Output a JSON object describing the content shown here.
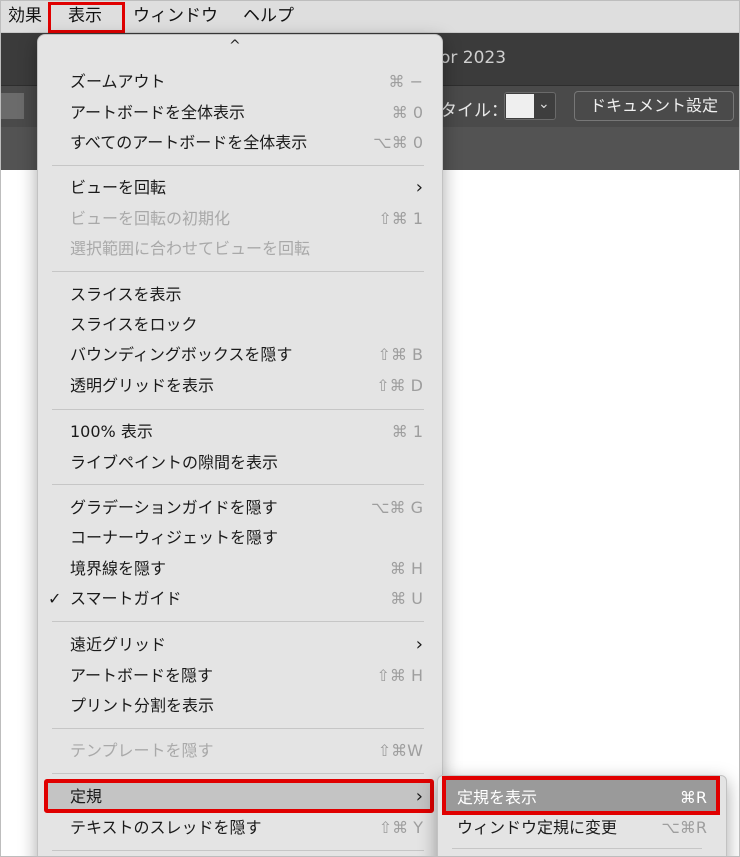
{
  "menubar": {
    "items": [
      "効果",
      "表示",
      "ウィンドウ",
      "ヘルプ"
    ]
  },
  "app": {
    "title_partial": "or 2023",
    "style_label": "タイル：",
    "document_settings_button": "ドキュメント設定"
  },
  "menu": {
    "scroll_indicator": "^",
    "items": [
      {
        "label": "ズームアウト",
        "shortcut": "⌘ −",
        "disabled": false
      },
      {
        "label": "アートボードを全体表示",
        "shortcut": "⌘ 0",
        "disabled": false
      },
      {
        "label": "すべてのアートボードを全体表示",
        "shortcut": "⌥⌘ 0",
        "disabled": false
      },
      {
        "label": "ビューを回転",
        "shortcut": "",
        "submenu": true,
        "disabled": false
      },
      {
        "label": "ビューを回転の初期化",
        "shortcut": "⇧⌘ 1",
        "disabled": true
      },
      {
        "label": "選択範囲に合わせてビューを回転",
        "shortcut": "",
        "disabled": true
      },
      {
        "label": "スライスを表示",
        "shortcut": "",
        "disabled": false
      },
      {
        "label": "スライスをロック",
        "shortcut": "",
        "disabled": false
      },
      {
        "label": "バウンディングボックスを隠す",
        "shortcut": "⇧⌘ B",
        "disabled": false
      },
      {
        "label": "透明グリッドを表示",
        "shortcut": "⇧⌘ D",
        "disabled": false
      },
      {
        "label": "100% 表示",
        "shortcut": "⌘ 1",
        "disabled": false
      },
      {
        "label": "ライブペイントの隙間を表示",
        "shortcut": "",
        "disabled": false
      },
      {
        "label": "グラデーションガイドを隠す",
        "shortcut": "⌥⌘ G",
        "disabled": false
      },
      {
        "label": "コーナーウィジェットを隠す",
        "shortcut": "",
        "disabled": false
      },
      {
        "label": "境界線を隠す",
        "shortcut": "⌘ H",
        "disabled": false
      },
      {
        "label": "スマートガイド",
        "shortcut": "⌘ U",
        "checked": true,
        "disabled": false
      },
      {
        "label": "遠近グリッド",
        "shortcut": "",
        "submenu": true,
        "disabled": false
      },
      {
        "label": "アートボードを隠す",
        "shortcut": "⇧⌘ H",
        "disabled": false
      },
      {
        "label": "プリント分割を表示",
        "shortcut": "",
        "disabled": false
      },
      {
        "label": "テンプレートを隠す",
        "shortcut": "⇧⌘W",
        "disabled": true
      },
      {
        "label": "定規",
        "shortcut": "",
        "submenu": true,
        "disabled": false
      },
      {
        "label": "テキストのスレッドを隠す",
        "shortcut": "⇧⌘ Y",
        "disabled": false
      }
    ],
    "check_mark": "✓",
    "submenu_arrow": "›"
  },
  "submenu": {
    "items": [
      {
        "label": "定規を表示",
        "shortcut": "⌘R"
      },
      {
        "label": "ウィンドウ定規に変更",
        "shortcut": "⌥⌘R"
      }
    ]
  },
  "colors": {
    "highlight_border": "#e00000",
    "menu_bg": "#e4e4e4",
    "app_dark": "#3b3b3b"
  }
}
